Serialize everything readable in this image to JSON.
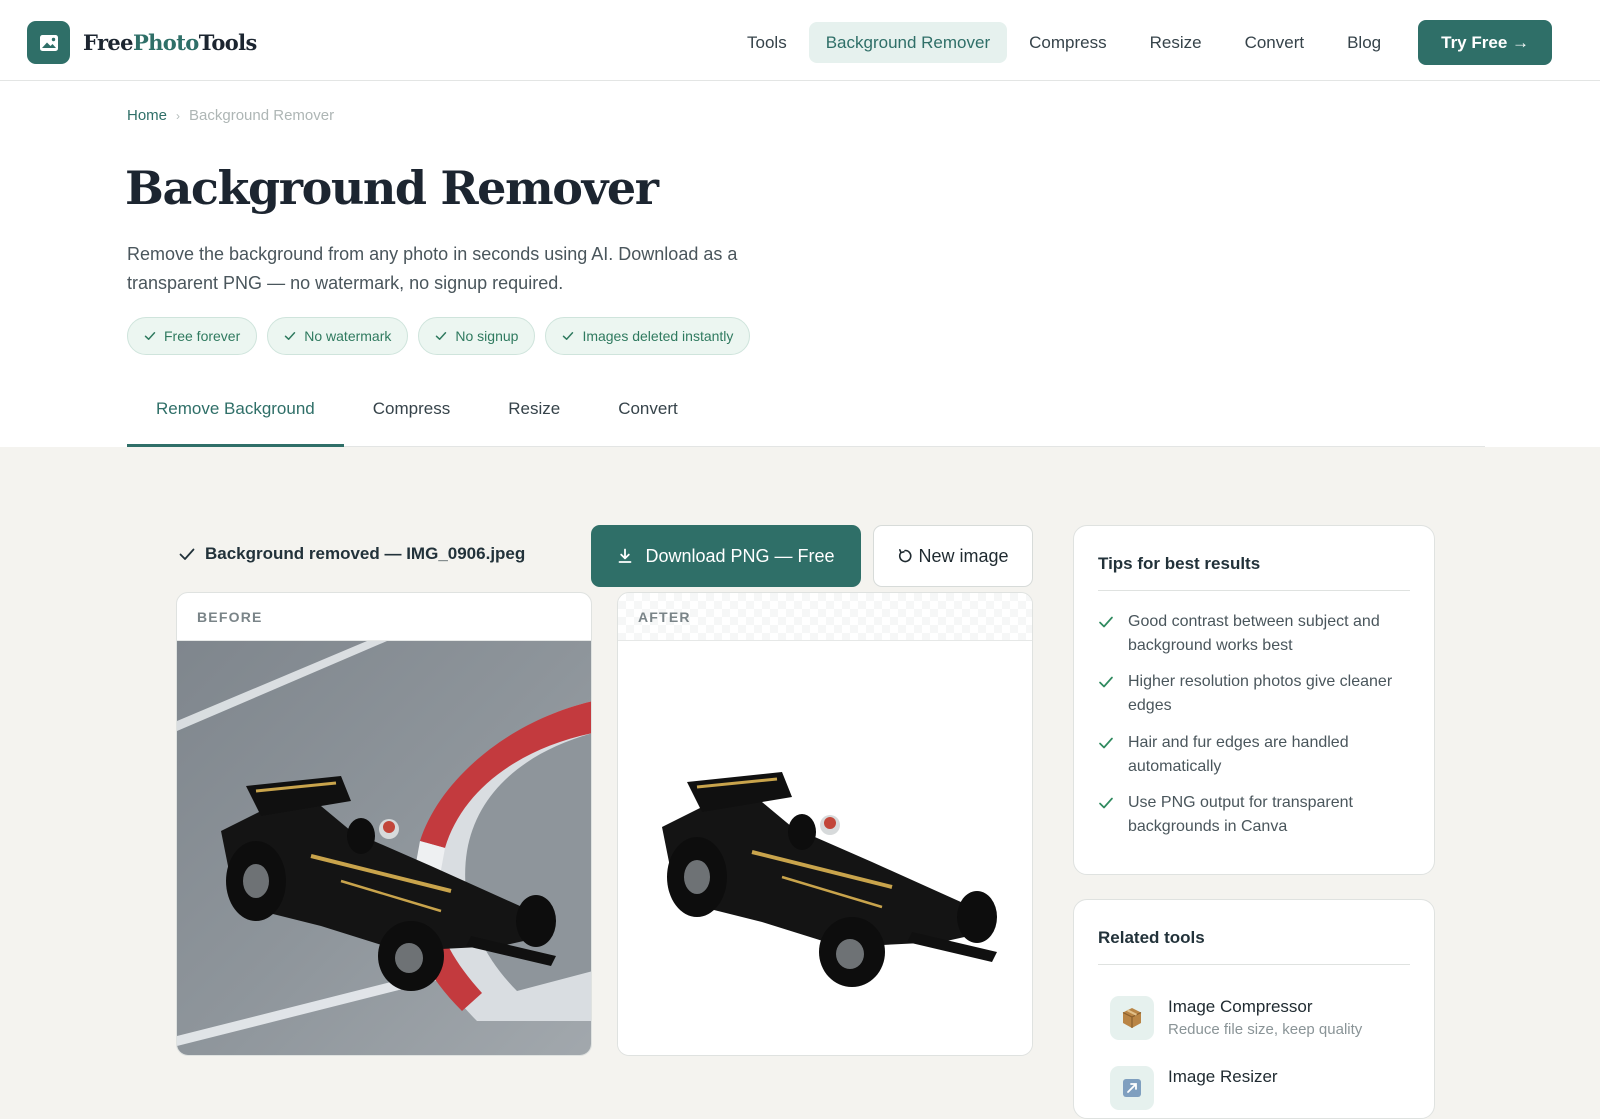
{
  "header": {
    "logo": {
      "part1": "Free",
      "part2": "Photo",
      "part3": "Tools",
      "icon": "image-icon"
    },
    "nav": [
      {
        "label": "Tools",
        "active": false
      },
      {
        "label": "Background Remover",
        "active": true
      },
      {
        "label": "Compress",
        "active": false
      },
      {
        "label": "Resize",
        "active": false
      },
      {
        "label": "Convert",
        "active": false
      },
      {
        "label": "Blog",
        "active": false
      }
    ],
    "cta_label": "Try Free →"
  },
  "breadcrumb": {
    "home": "Home",
    "separator": "›",
    "current": "Background Remover"
  },
  "hero": {
    "title": "Background Remover",
    "subtitle": "Remove the background from any photo in seconds using AI. Download as a transparent PNG — no watermark, no signup required.",
    "badges": [
      "Free forever",
      "No watermark",
      "No signup",
      "Images deleted instantly"
    ]
  },
  "tabs": [
    {
      "label": "Remove Background",
      "active": true
    },
    {
      "label": "Compress",
      "active": false
    },
    {
      "label": "Resize",
      "active": false
    },
    {
      "label": "Convert",
      "active": false
    }
  ],
  "workspace": {
    "status": "Background removed — IMG_0906.jpeg",
    "download_label": "Download PNG — Free",
    "new_image_label": "New image",
    "before_label": "BEFORE",
    "after_label": "AFTER"
  },
  "tips": {
    "title": "Tips for best results",
    "items": [
      "Good contrast between subject and background works best",
      "Higher resolution photos give cleaner edges",
      "Hair and fur edges are handled automatically",
      "Use PNG output for transparent backgrounds in Canva"
    ]
  },
  "related": {
    "title": "Related tools",
    "items": [
      {
        "name": "Image Compressor",
        "desc": "Reduce file size, keep quality",
        "icon": "package-icon"
      },
      {
        "name": "Image Resizer",
        "desc": "",
        "icon": "resize-icon"
      }
    ]
  },
  "colors": {
    "brand": "#2f6f68",
    "brand_tint": "#e6f1ee",
    "badge_text": "#2f7a5f",
    "page_bg": "#f4f3ef"
  }
}
